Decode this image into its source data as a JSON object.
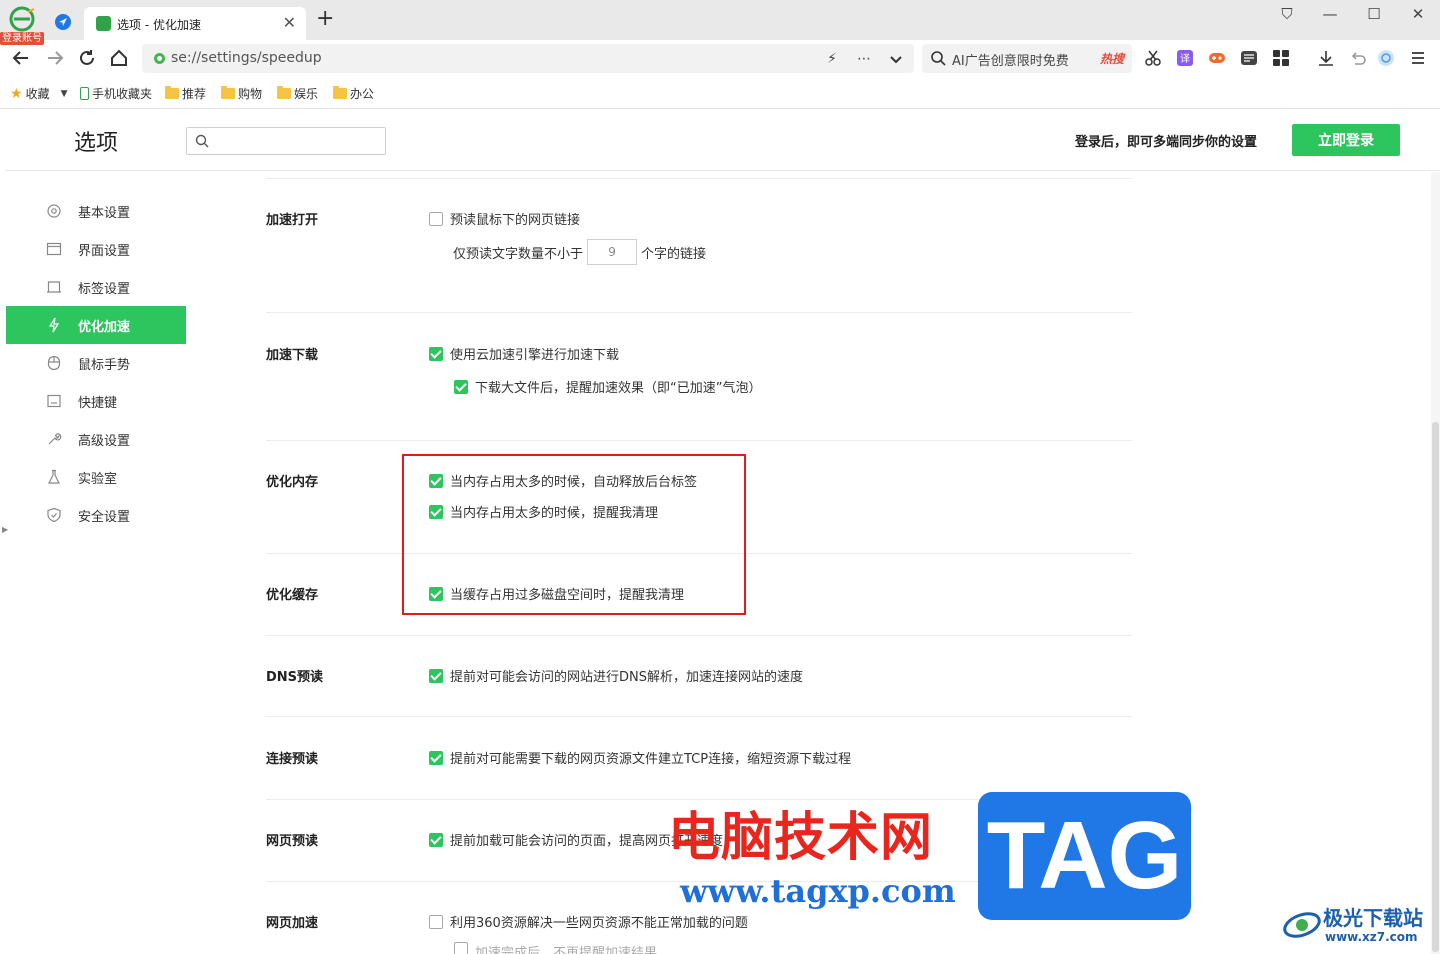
{
  "browser": {
    "login_badge": "登录账号",
    "tab_title": "选项 - 优化加速",
    "tab_close": "✕",
    "new_tab": "+",
    "window_controls": {
      "tshirt": "⛉",
      "minimize": "—",
      "maximize": "☐",
      "close": "✕"
    },
    "address_url": "se://settings/speedup",
    "search_hint": "AI广告创意限时免费",
    "hot_label": "热搜",
    "bookmarks": [
      {
        "label": "收藏",
        "kind": "star"
      },
      {
        "label": "手机收藏夹",
        "kind": "phone"
      },
      {
        "label": "推荐",
        "kind": "folder"
      },
      {
        "label": "购物",
        "kind": "folder"
      },
      {
        "label": "娱乐",
        "kind": "folder"
      },
      {
        "label": "办公",
        "kind": "folder"
      }
    ]
  },
  "header": {
    "title": "选项",
    "search_placeholder": "",
    "sync_hint": "登录后，即可多端同步你的设置",
    "login_button": "立即登录"
  },
  "sidebar": {
    "items": [
      {
        "label": "基本设置",
        "icon": "gear-icon",
        "active": false
      },
      {
        "label": "界面设置",
        "icon": "window-icon",
        "active": false
      },
      {
        "label": "标签设置",
        "icon": "tab-icon",
        "active": false
      },
      {
        "label": "优化加速",
        "icon": "lightning-icon",
        "active": true
      },
      {
        "label": "鼠标手势",
        "icon": "mouse-icon",
        "active": false
      },
      {
        "label": "快捷键",
        "icon": "keyboard-icon",
        "active": false
      },
      {
        "label": "高级设置",
        "icon": "wrench-icon",
        "active": false
      },
      {
        "label": "实验室",
        "icon": "flask-icon",
        "active": false
      },
      {
        "label": "安全设置",
        "icon": "shield-icon",
        "active": false
      }
    ]
  },
  "sections": {
    "open": {
      "label": "加速打开",
      "prefetch": {
        "text": "预读鼠标下的网页链接",
        "checked": false
      },
      "min_chars_prefix": "仅预读文字数量不小于",
      "min_chars_value": "9",
      "min_chars_suffix": "个字的链接"
    },
    "download": {
      "label": "加速下载",
      "cloud": {
        "text": "使用云加速引擎进行加速下载",
        "checked": true
      },
      "bubble": {
        "text": "下载大文件后，提醒加速效果（即“已加速”气泡）",
        "checked": true
      }
    },
    "memory": {
      "label": "优化内存",
      "auto_release": {
        "text": "当内存占用太多的时候，自动释放后台标签",
        "checked": true
      },
      "remind": {
        "text": "当内存占用太多的时候，提醒我清理",
        "checked": true
      }
    },
    "cache": {
      "label": "优化缓存",
      "remind": {
        "text": "当缓存占用过多磁盘空间时，提醒我清理",
        "checked": true
      }
    },
    "dns": {
      "label": "DNS预读",
      "opt": {
        "text": "提前对可能会访问的网站进行DNS解析，加速连接网站的速度",
        "checked": true
      }
    },
    "connect": {
      "label": "连接预读",
      "opt": {
        "text": "提前对可能需要下载的网页资源文件建立TCP连接，缩短资源下载过程",
        "checked": true
      }
    },
    "page_prefetch": {
      "label": "网页预读",
      "opt": {
        "text": "提前加载可能会访问的页面，提高网页打开速度",
        "checked": true
      }
    },
    "page_accel": {
      "label": "网页加速",
      "opt": {
        "text": "利用360资源解决一些网页资源不能正常加载的问题",
        "checked": false
      },
      "sub": {
        "text": "加速完成后，不再提醒加速结果",
        "checked": false
      }
    }
  },
  "watermarks": {
    "cn_title": "电脑技术网",
    "url": "www.tagxp.com",
    "tag": "TAG",
    "site2_title": "极光下载站",
    "site2_url": "www.xz7.com"
  },
  "colors": {
    "accent": "#2dc55e",
    "highlight": "#e31b1b"
  }
}
